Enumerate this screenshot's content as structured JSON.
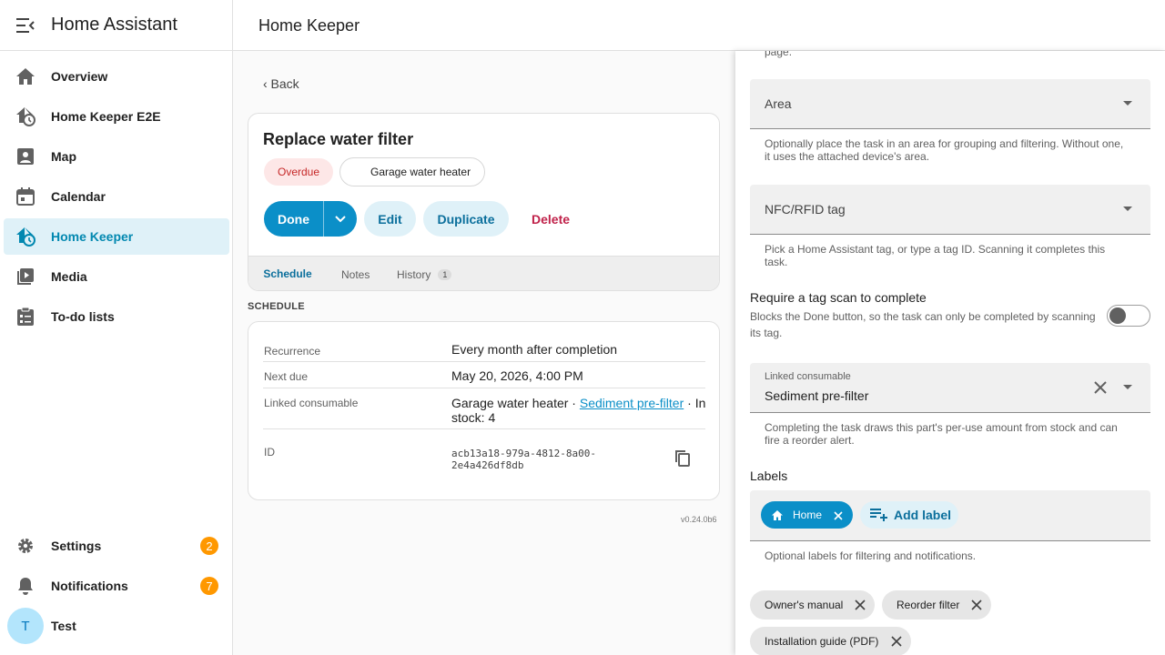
{
  "sidebar": {
    "title": "Home Assistant",
    "items": [
      {
        "label": "Overview",
        "icon": "home-icon"
      },
      {
        "label": "Home Keeper E2E",
        "icon": "home-clock-icon"
      },
      {
        "label": "Map",
        "icon": "map-icon"
      },
      {
        "label": "Calendar",
        "icon": "calendar-icon"
      },
      {
        "label": "Home Keeper",
        "icon": "home-clock-icon",
        "active": true
      },
      {
        "label": "Media",
        "icon": "media-icon"
      },
      {
        "label": "To-do lists",
        "icon": "todo-list-icon"
      }
    ],
    "settings": {
      "label": "Settings",
      "badge": "2"
    },
    "notifications": {
      "label": "Notifications",
      "badge": "7"
    },
    "user": {
      "initial": "T",
      "name": "Test"
    }
  },
  "topbar": {
    "title": "Home Keeper"
  },
  "main": {
    "back": "‹ Back",
    "task": {
      "title": "Replace water filter",
      "status": "Overdue",
      "device": "Garage water heater",
      "buttons": {
        "done": "Done",
        "edit": "Edit",
        "duplicate": "Duplicate",
        "delete": "Delete"
      },
      "tabs": [
        {
          "label": "Schedule",
          "active": true
        },
        {
          "label": "Notes"
        },
        {
          "label": "History",
          "count": "1"
        }
      ]
    },
    "schedule": {
      "heading": "SCHEDULE",
      "rows": [
        {
          "key": "Recurrence",
          "value": "Every month after completion"
        },
        {
          "key": "Next due",
          "value": "May 20, 2026, 4:00 PM"
        },
        {
          "key": "Linked consumable",
          "value_prefix": "Garage water heater · ",
          "value_link": "Sediment pre-filter",
          "value_suffix": " · In stock: 4"
        },
        {
          "key": "ID",
          "value": "acb13a18-979a-4812-8a00-2e4a426df8db"
        }
      ]
    },
    "version": "v0.24.0b6"
  },
  "panel": {
    "top_fragment": "page.",
    "area": {
      "label": "Area",
      "help": "Optionally place the task in an area for grouping and filtering. Without one, it uses the attached device's area."
    },
    "nfc": {
      "label": "NFC/RFID tag",
      "help": "Pick a Home Assistant tag, or type a tag ID. Scanning it completes this task."
    },
    "require_tag": {
      "title": "Require a tag scan to complete",
      "desc": "Blocks the Done button, so the task can only be completed by scanning its tag.",
      "enabled": false
    },
    "consumable": {
      "label": "Linked consumable",
      "value": "Sediment pre-filter",
      "help": "Completing the task draws this part's per-use amount from stock and can fire a reorder alert."
    },
    "labels": {
      "heading": "Labels",
      "chips": [
        {
          "label": "Home",
          "icon": "home-icon"
        }
      ],
      "add": "Add label",
      "help": "Optional labels for filtering and notifications."
    },
    "attachments": [
      "Owner's manual",
      "Reorder filter",
      "Installation guide (PDF)"
    ]
  },
  "colors": {
    "accent": "#0b8fc8",
    "active_bg": "#dff1f8",
    "badge": "#ff9800",
    "overdue_bg": "#fde7e7",
    "delete": "#c0224a"
  }
}
